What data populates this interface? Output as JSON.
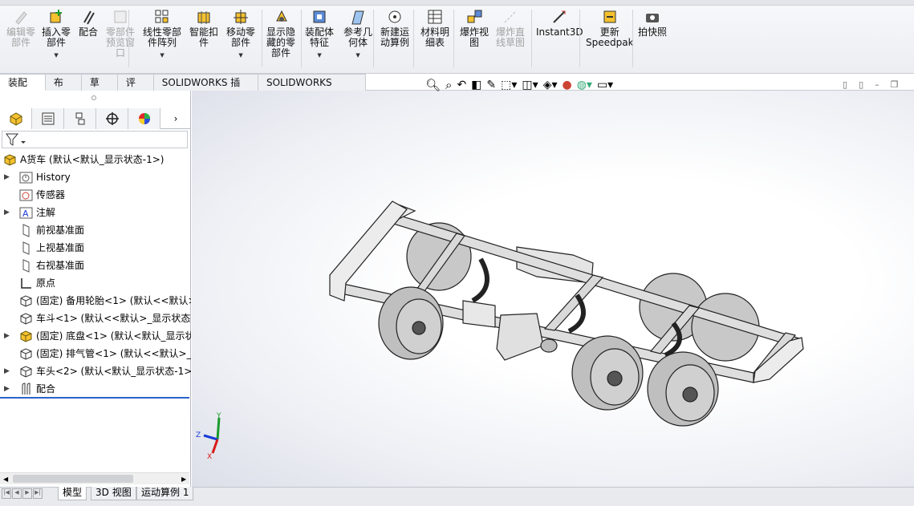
{
  "ribbon": {
    "buttons": [
      {
        "label": "编辑零\n部件",
        "icon": "edit-component-icon",
        "disabled": true
      },
      {
        "label": "插入零\n部件",
        "icon": "insert-component-icon",
        "disabled": false,
        "dropdown": true
      },
      {
        "label": "配合",
        "icon": "mate-icon",
        "disabled": false
      },
      {
        "label": "零部件\n预览窗\n口",
        "icon": "component-preview-icon",
        "disabled": true
      },
      {
        "label": "线性零部\n件阵列",
        "icon": "linear-pattern-icon",
        "disabled": false,
        "dropdown": true
      },
      {
        "label": "智能扣\n件",
        "icon": "smart-fasteners-icon",
        "disabled": false
      },
      {
        "label": "移动零\n部件",
        "icon": "move-component-icon",
        "disabled": false,
        "dropdown": true
      },
      {
        "label": "显示隐\n藏的零\n部件",
        "icon": "show-hidden-icon",
        "disabled": false
      },
      {
        "label": "装配体\n特征",
        "icon": "assembly-features-icon",
        "disabled": false,
        "dropdown": true
      },
      {
        "label": "参考几\n何体",
        "icon": "reference-geometry-icon",
        "disabled": false,
        "dropdown": true
      },
      {
        "label": "新建运\n动算例",
        "icon": "new-motion-study-icon",
        "disabled": false
      },
      {
        "label": "材料明\n细表",
        "icon": "bom-icon",
        "disabled": false
      },
      {
        "label": "爆炸视\n图",
        "icon": "exploded-view-icon",
        "disabled": false
      },
      {
        "label": "爆炸直\n线草图",
        "icon": "explode-line-sketch-icon",
        "disabled": true
      },
      {
        "label": "Instant3D",
        "icon": "instant3d-icon",
        "disabled": false
      },
      {
        "label": "更新\nSpeedpak",
        "icon": "speedpak-icon",
        "disabled": false
      },
      {
        "label": "拍快照",
        "icon": "snapshot-icon",
        "disabled": false
      }
    ]
  },
  "tabs": [
    "装配体",
    "布局",
    "草图",
    "评估",
    "SOLIDWORKS 插件",
    "SOLIDWORKS MBD"
  ],
  "tree": [
    {
      "label": "A货车  (默认<默认_显示状态-1>)",
      "icon": "assembly-icon",
      "expand": ""
    },
    {
      "label": "History",
      "icon": "history-icon",
      "expand": "▶"
    },
    {
      "label": "传感器",
      "icon": "sensor-icon",
      "expand": ""
    },
    {
      "label": "注解",
      "icon": "annotation-icon",
      "expand": "▶"
    },
    {
      "label": "前视基准面",
      "icon": "plane-icon",
      "expand": ""
    },
    {
      "label": "上视基准面",
      "icon": "plane-icon",
      "expand": ""
    },
    {
      "label": "右视基准面",
      "icon": "plane-icon",
      "expand": ""
    },
    {
      "label": "原点",
      "icon": "origin-icon",
      "expand": ""
    },
    {
      "label": "(固定) 备用轮胎<1> (默认<<默认>_",
      "icon": "part-icon",
      "expand": ""
    },
    {
      "label": "车斗<1> (默认<<默认>_显示状态",
      "icon": "part-icon",
      "expand": ""
    },
    {
      "label": "(固定) 底盘<1> (默认<默认_显示状",
      "icon": "subassembly-icon",
      "expand": "▶"
    },
    {
      "label": "(固定) 排气管<1> (默认<<默认>_",
      "icon": "part-icon",
      "expand": ""
    },
    {
      "label": "车头<2> (默认<默认_显示状态-1>",
      "icon": "part-icon",
      "expand": "▶"
    },
    {
      "label": "配合",
      "icon": "mates-icon",
      "expand": "▶"
    }
  ],
  "bottom_tabs": [
    "模型",
    "3D 视图",
    "运动算例 1"
  ],
  "triad": {
    "x": "X",
    "y": "Y",
    "z": "Z"
  }
}
